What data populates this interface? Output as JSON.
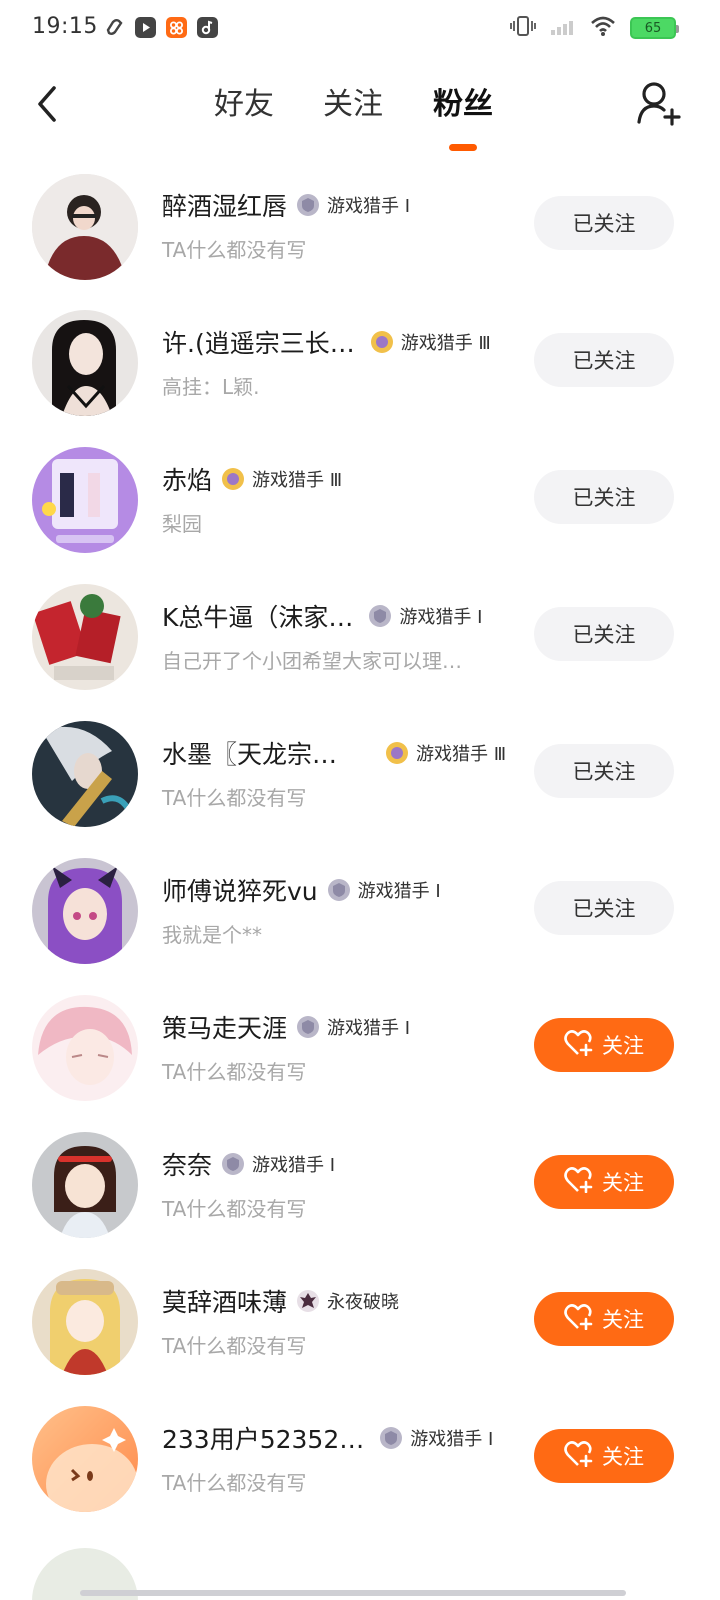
{
  "status_bar": {
    "time": "19:15",
    "battery": "65",
    "app_icons": [
      "link-app-icon",
      "video-app-icon",
      "game-app-icon",
      "music-app-icon"
    ]
  },
  "header": {
    "tabs": [
      {
        "label": "好友",
        "active": false
      },
      {
        "label": "关注",
        "active": false
      },
      {
        "label": "粉丝",
        "active": true
      }
    ]
  },
  "accent_color": "#ff6a14",
  "fans": [
    {
      "name": "醉酒湿红唇",
      "badge": "游戏猎手 Ⅰ",
      "badge_tier": "silver",
      "bio": "TA什么都没有写",
      "button": "已关注",
      "followed": true
    },
    {
      "name": "许.(逍遥宗三长…",
      "badge": "游戏猎手 Ⅲ",
      "badge_tier": "gold",
      "bio": "高挂：L颖.",
      "button": "已关注",
      "followed": true
    },
    {
      "name": "赤焰",
      "badge": "游戏猎手 Ⅲ",
      "badge_tier": "gold",
      "bio": "梨园",
      "button": "已关注",
      "followed": true
    },
    {
      "name": "K总牛逼（沫家…",
      "badge": "游戏猎手 Ⅰ",
      "badge_tier": "silver",
      "bio": "自己开了个小团希望大家可以理…",
      "button": "已关注",
      "followed": true
    },
    {
      "name": "水墨〖天龙宗…",
      "badge": "游戏猎手 Ⅲ",
      "badge_tier": "gold",
      "bio": "TA什么都没有写",
      "button": "已关注",
      "followed": true
    },
    {
      "name": "师傅说猝死vu",
      "badge": "游戏猎手 Ⅰ",
      "badge_tier": "silver",
      "bio": "我就是个**",
      "button": "已关注",
      "followed": true
    },
    {
      "name": "策马走天涯",
      "badge": "游戏猎手 Ⅰ",
      "badge_tier": "silver",
      "bio": "TA什么都没有写",
      "button": "关注",
      "followed": false
    },
    {
      "name": "奈奈",
      "badge": "游戏猎手 Ⅰ",
      "badge_tier": "silver",
      "bio": "TA什么都没有写",
      "button": "关注",
      "followed": false
    },
    {
      "name": "莫辞酒味薄",
      "badge": "永夜破晓",
      "badge_tier": "dark",
      "bio": "TA什么都没有写",
      "button": "关注",
      "followed": false
    },
    {
      "name": "233用户52352…",
      "badge": "游戏猎手 Ⅰ",
      "badge_tier": "silver",
      "bio": "TA什么都没有写",
      "button": "关注",
      "followed": false
    }
  ]
}
